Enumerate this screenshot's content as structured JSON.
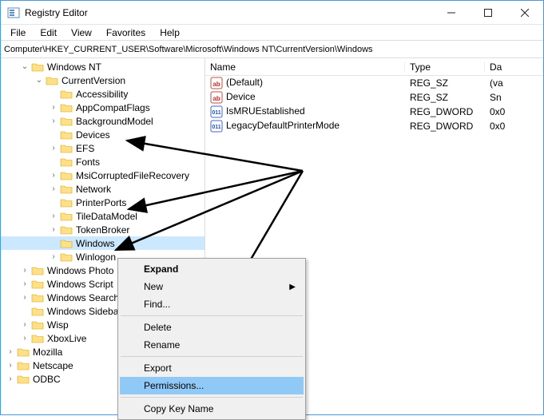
{
  "window": {
    "title": "Registry Editor",
    "minimize": "–",
    "maximize": "▢",
    "close": "✕"
  },
  "menu": [
    "File",
    "Edit",
    "View",
    "Favorites",
    "Help"
  ],
  "address": "Computer\\HKEY_CURRENT_USER\\Software\\Microsoft\\Windows NT\\CurrentVersion\\Windows",
  "tree": [
    {
      "d": 1,
      "l": "Windows NT",
      "e": true
    },
    {
      "d": 2,
      "l": "CurrentVersion",
      "e": true
    },
    {
      "d": 3,
      "l": "Accessibility",
      "e": false
    },
    {
      "d": 3,
      "l": "AppCompatFlags",
      "e": false,
      "hasChild": true
    },
    {
      "d": 3,
      "l": "BackgroundModel",
      "e": false,
      "hasChild": true
    },
    {
      "d": 3,
      "l": "Devices",
      "e": false
    },
    {
      "d": 3,
      "l": "EFS",
      "e": false,
      "hasChild": true
    },
    {
      "d": 3,
      "l": "Fonts",
      "e": false
    },
    {
      "d": 3,
      "l": "MsiCorruptedFileRecovery",
      "e": false,
      "hasChild": true
    },
    {
      "d": 3,
      "l": "Network",
      "e": false,
      "hasChild": true
    },
    {
      "d": 3,
      "l": "PrinterPorts",
      "e": false
    },
    {
      "d": 3,
      "l": "TileDataModel",
      "e": false,
      "hasChild": true
    },
    {
      "d": 3,
      "l": "TokenBroker",
      "e": false,
      "hasChild": true
    },
    {
      "d": 3,
      "l": "Windows",
      "e": false,
      "selected": true
    },
    {
      "d": 3,
      "l": "Winlogon",
      "e": false,
      "hasChild": true,
      "cut": true
    },
    {
      "d": 1,
      "l": "Windows Photo",
      "e": false,
      "hasChild": true,
      "cut": true
    },
    {
      "d": 1,
      "l": "Windows Script",
      "e": false,
      "hasChild": true,
      "cut": true
    },
    {
      "d": 1,
      "l": "Windows Search",
      "e": false,
      "hasChild": true,
      "cut": true
    },
    {
      "d": 1,
      "l": "Windows Sideba",
      "e": false,
      "cut": true
    },
    {
      "d": 1,
      "l": "Wisp",
      "e": false,
      "hasChild": true
    },
    {
      "d": 1,
      "l": "XboxLive",
      "e": false,
      "hasChild": true
    },
    {
      "d": 0,
      "l": "Mozilla",
      "e": false,
      "hasChild": true
    },
    {
      "d": 0,
      "l": "Netscape",
      "e": false,
      "hasChild": true
    },
    {
      "d": 0,
      "l": "ODBC",
      "e": false,
      "hasChild": true
    }
  ],
  "list": {
    "headers": {
      "name": "Name",
      "type": "Type",
      "data": "Da"
    },
    "rows": [
      {
        "icon": "string",
        "name": "(Default)",
        "type": "REG_SZ",
        "data": "(va"
      },
      {
        "icon": "string",
        "name": "Device",
        "type": "REG_SZ",
        "data": "Sn"
      },
      {
        "icon": "dword",
        "name": "IsMRUEstablished",
        "type": "REG_DWORD",
        "data": "0x0"
      },
      {
        "icon": "dword",
        "name": "LegacyDefaultPrinterMode",
        "type": "REG_DWORD",
        "data": "0x0"
      }
    ]
  },
  "context": {
    "items": [
      {
        "label": "Expand",
        "bold": true
      },
      {
        "label": "New",
        "submenu": true
      },
      {
        "label": "Find..."
      },
      {
        "sep": true
      },
      {
        "label": "Delete"
      },
      {
        "label": "Rename"
      },
      {
        "sep": true
      },
      {
        "label": "Export"
      },
      {
        "label": "Permissions...",
        "highlight": true
      },
      {
        "sep": true
      },
      {
        "label": "Copy Key Name"
      }
    ]
  }
}
